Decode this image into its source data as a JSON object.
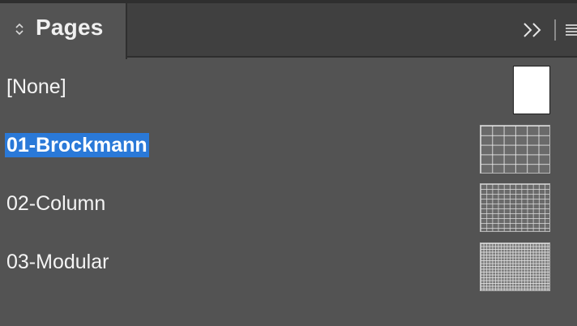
{
  "panel": {
    "tab_title": "Pages",
    "icons": {
      "tab_toggle": "expand-collapse-arrows-icon",
      "collapse": "double-chevron-right-icon",
      "menu": "hamburger-menu-icon"
    }
  },
  "masters": [
    {
      "label": "[None]",
      "thumbnail": "blank-page",
      "selected": false
    },
    {
      "label": "01-Brockmann",
      "thumbnail": "grid-page",
      "selected": true
    },
    {
      "label": "02-Column",
      "thumbnail": "grid-page",
      "selected": false
    },
    {
      "label": "03-Modular",
      "thumbnail": "grid-page",
      "selected": false
    }
  ],
  "colors": {
    "panel_bg": "#535353",
    "tabbar_bg": "#404040",
    "selection": "#2a79d8"
  }
}
